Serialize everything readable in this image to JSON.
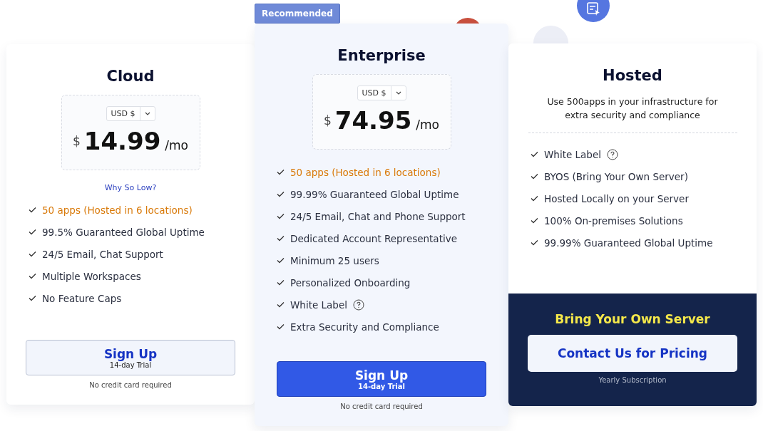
{
  "plans": [
    {
      "kind": "priced",
      "featured": false,
      "name": "Cloud",
      "currency": "USD $",
      "symbol": "$",
      "price": "14.99",
      "period": "/mo",
      "link": "Why So Low?",
      "features": [
        {
          "text": "50 apps (Hosted in 6 locations)",
          "accent": true,
          "info": false
        },
        {
          "text": "99.5% Guaranteed Global Uptime",
          "accent": false,
          "info": false
        },
        {
          "text": "24/5 Email, Chat Support",
          "accent": false,
          "info": false
        },
        {
          "text": "Multiple Workspaces",
          "accent": false,
          "info": false
        },
        {
          "text": "No Feature Caps",
          "accent": false,
          "info": false
        }
      ],
      "button": {
        "label": "Sign Up",
        "sublabel": "14-day Trial"
      },
      "note": "No credit card required"
    },
    {
      "kind": "priced",
      "featured": true,
      "badge": "Recommended",
      "name": "Enterprise",
      "currency": "USD $",
      "symbol": "$",
      "price": "74.95",
      "period": "/mo",
      "features": [
        {
          "text": "50 apps (Hosted in 6 locations)",
          "accent": true,
          "info": false
        },
        {
          "text": "99.99% Guaranteed Global Uptime",
          "accent": false,
          "info": false
        },
        {
          "text": "24/5 Email, Chat and Phone Support",
          "accent": false,
          "info": false
        },
        {
          "text": "Dedicated Account Representative",
          "accent": false,
          "info": false
        },
        {
          "text": "Minimum 25 users",
          "accent": false,
          "info": false
        },
        {
          "text": "Personalized Onboarding",
          "accent": false,
          "info": false
        },
        {
          "text": "White Label",
          "accent": false,
          "info": true
        },
        {
          "text": "Extra Security and Compliance",
          "accent": false,
          "info": false
        }
      ],
      "button": {
        "label": "Sign Up",
        "sublabel": "14-day Trial"
      },
      "note": "No credit card required"
    },
    {
      "kind": "hosted",
      "featured": false,
      "name": "Hosted",
      "description": "Use 500apps in your infrastructure for extra security and compliance",
      "features": [
        {
          "text": "White Label",
          "accent": false,
          "info": true
        },
        {
          "text": "BYOS (Bring Your Own Server)",
          "accent": false,
          "info": false
        },
        {
          "text": "Hosted Locally on your Server",
          "accent": false,
          "info": false
        },
        {
          "text": "100% On-premises Solutions",
          "accent": false,
          "info": false
        },
        {
          "text": "99.99% Guaranteed Global Uptime",
          "accent": false,
          "info": false
        }
      ],
      "footer": {
        "heading": "Bring Your Own Server",
        "button": "Contact Us for Pricing",
        "note": "Yearly Subscription"
      }
    }
  ]
}
